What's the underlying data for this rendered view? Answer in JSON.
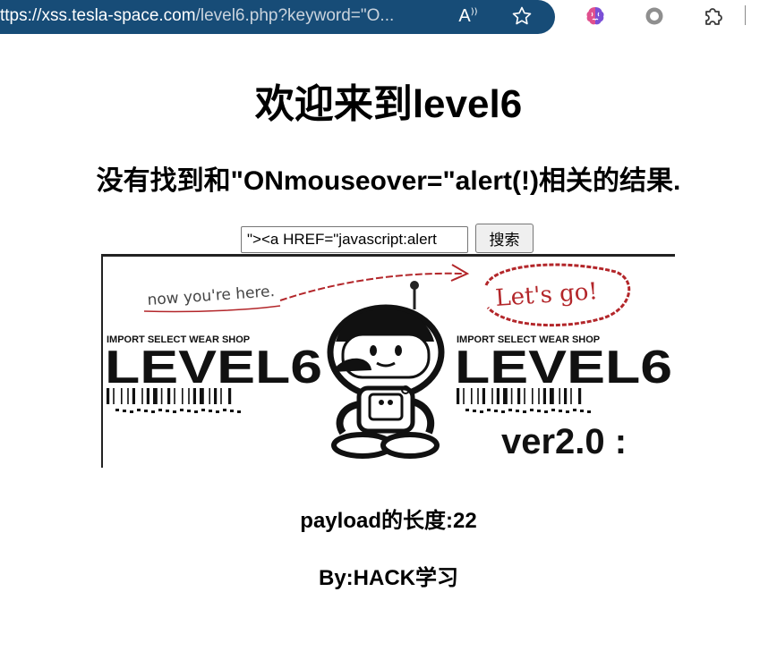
{
  "browser": {
    "url_host": "ttps://xss.tesla-space.com",
    "url_path": "/level6.php?keyword=\"O...",
    "read_aloud_label": "A",
    "icons": [
      "read-aloud-icon",
      "favorite-star-icon",
      "brain-extension-icon",
      "circle-extension-icon",
      "puzzle-extension-icon"
    ]
  },
  "page": {
    "title": "欢迎来到level6",
    "result_text": "没有找到和\"ONmouseover=\"alert(!)相关的结果.",
    "search": {
      "value": "\"><a HREF=\"javascript:alert",
      "button_label": "搜索"
    },
    "payload_length": "payload的长度:22",
    "author": "By:HACK学习"
  },
  "banner": {
    "here_text": "now you're here.",
    "go_text": "Let's go!",
    "shop_label_left": "IMPORT SELECT WEAR SHOP",
    "shop_label_right": "IMPORT SELECT WEAR SHOP",
    "level_left": "LEVEL6",
    "level_right": "LEVEL6",
    "version": "ver2.0 :",
    "accent_color": "#b3262a"
  }
}
